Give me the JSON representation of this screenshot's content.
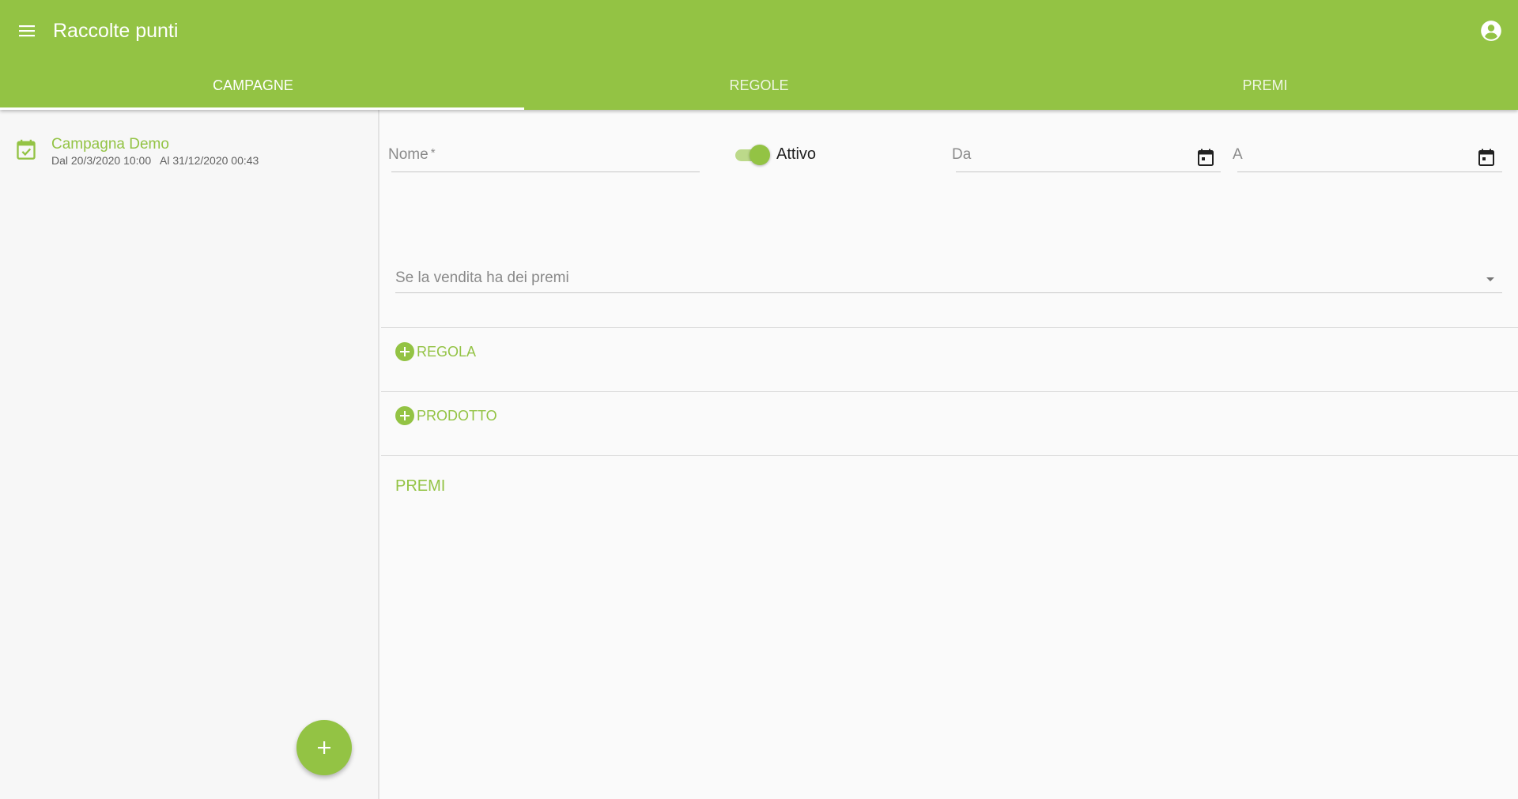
{
  "app": {
    "title": "Raccolte punti",
    "accent_color": "#93c344",
    "icons": {
      "menu": "hamburger-menu-icon",
      "account": "account-circle-icon"
    }
  },
  "tabs": [
    {
      "label": "CAMPAGNE",
      "active": true
    },
    {
      "label": "REGOLE",
      "active": false
    },
    {
      "label": "PREMI",
      "active": false
    }
  ],
  "sidebar": {
    "campaigns": [
      {
        "name": "Campagna Demo",
        "dates": "Dal 20/3/2020 10:00   Al 31/12/2020 00:43",
        "icon": "calendar-check-icon"
      }
    ],
    "fab_icon": "plus-icon"
  },
  "form": {
    "nome": {
      "label": "Nome",
      "required_mark": "*",
      "value": ""
    },
    "attivo": {
      "label": "Attivo",
      "checked": true
    },
    "da": {
      "label": "Da",
      "value": "",
      "icon": "calendar-icon"
    },
    "a": {
      "label": "A",
      "value": "",
      "icon": "calendar-icon"
    },
    "premi_select": {
      "label": "Se la vendita ha dei premi",
      "value": ""
    },
    "add_regola": "REGOLA",
    "add_prodotto": "PRODOTTO",
    "premi_title": "PREMI"
  }
}
